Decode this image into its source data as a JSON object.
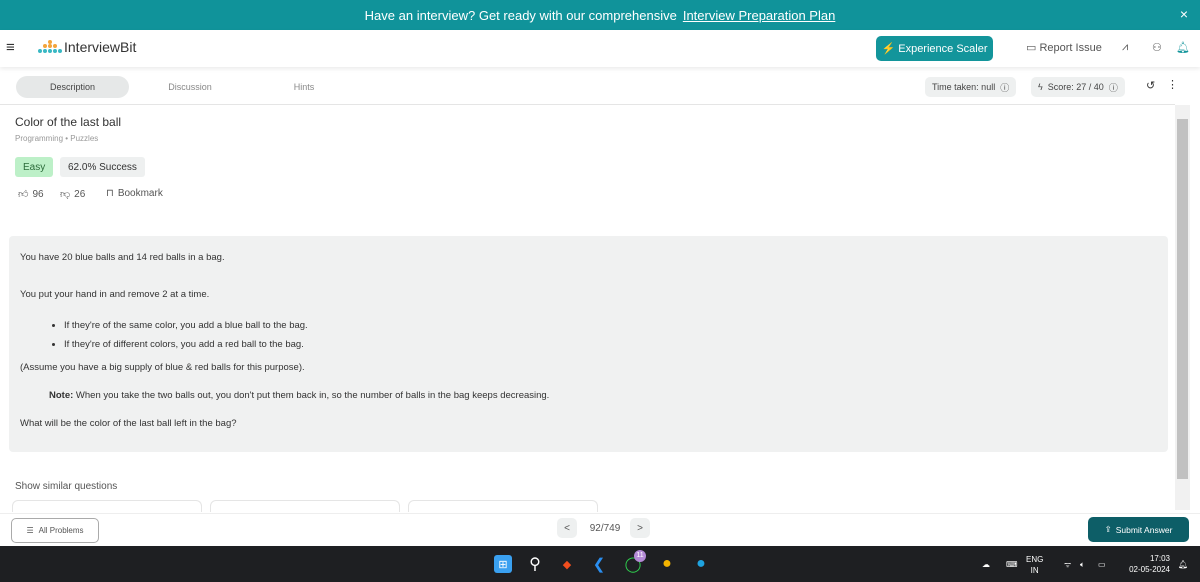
{
  "banner": {
    "text": "Have an interview? Get ready with our comprehensive",
    "link": "Interview Preparation Plan",
    "close": "×"
  },
  "header": {
    "logo": "InterviewBit",
    "experience_btn": "Experience Scaler",
    "report_issue": "Report Issue"
  },
  "tabs": [
    {
      "label": "Description",
      "active": true
    },
    {
      "label": "Discussion"
    },
    {
      "label": "Hints"
    }
  ],
  "status": {
    "time_taken": "Time taken: null",
    "score": "Score: 27 / 40"
  },
  "problem": {
    "title": "Color of the last ball",
    "tags": "Programming • Puzzles",
    "difficulty": "Easy",
    "success": "62.0% Success",
    "likes": "96",
    "dislikes": "26",
    "bookmark": "Bookmark",
    "p1": "You have 20 blue balls and 14 red balls in a bag.",
    "p2": "You put your hand in and remove 2 at a time.",
    "bullets": [
      "If they're of the same color, you add a blue ball to the bag.",
      "If they're of different colors, you add a red ball to the bag."
    ],
    "p3": "(Assume you have a big supply of blue & red balls for this purpose).",
    "note_label": "Note:",
    "note": " When you take the two balls out, you don't put them back in, so the number of balls in the bag keeps decreasing.",
    "question": "What will be the color of the last ball left in the bag?"
  },
  "similar": "Show similar questions",
  "bottom": {
    "all_problems": "All Problems",
    "page": "92/749",
    "prev": "<",
    "next": ">",
    "submit": "Submit Answer"
  },
  "taskbar": {
    "whatsapp_badge": "11",
    "lang": "ENG",
    "region": "IN",
    "time": "17:03",
    "date": "02-05-2024"
  },
  "colors": {
    "banner": "#10939a",
    "submit": "#0d5e67",
    "easy": "#bdf0c8"
  }
}
